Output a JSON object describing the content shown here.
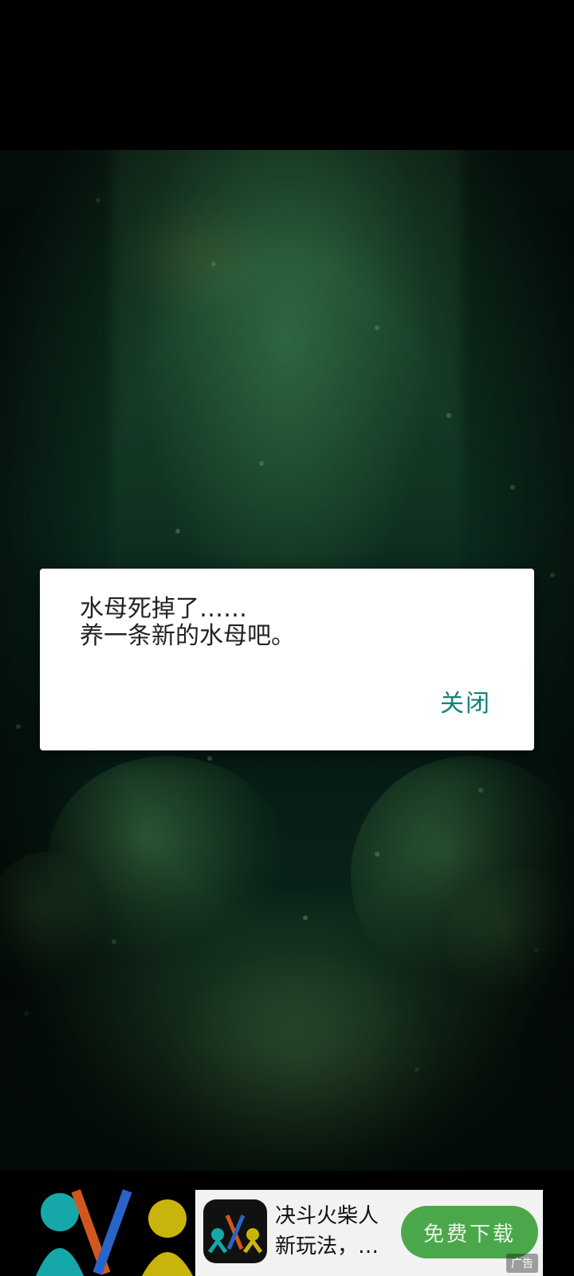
{
  "dialog": {
    "message_line1": "水母死掉了……",
    "message_line2": "养一条新的水母吧。",
    "close_label": "关闭"
  },
  "ad": {
    "title_line1": "决斗火柴人",
    "title_line2": "新玩法，…",
    "download_label": "免费下载",
    "badge_label": "广告"
  },
  "colors": {
    "accent": "#0d8577",
    "download_button": "#4aa84a",
    "scene_tint": "#0b2a1c"
  }
}
